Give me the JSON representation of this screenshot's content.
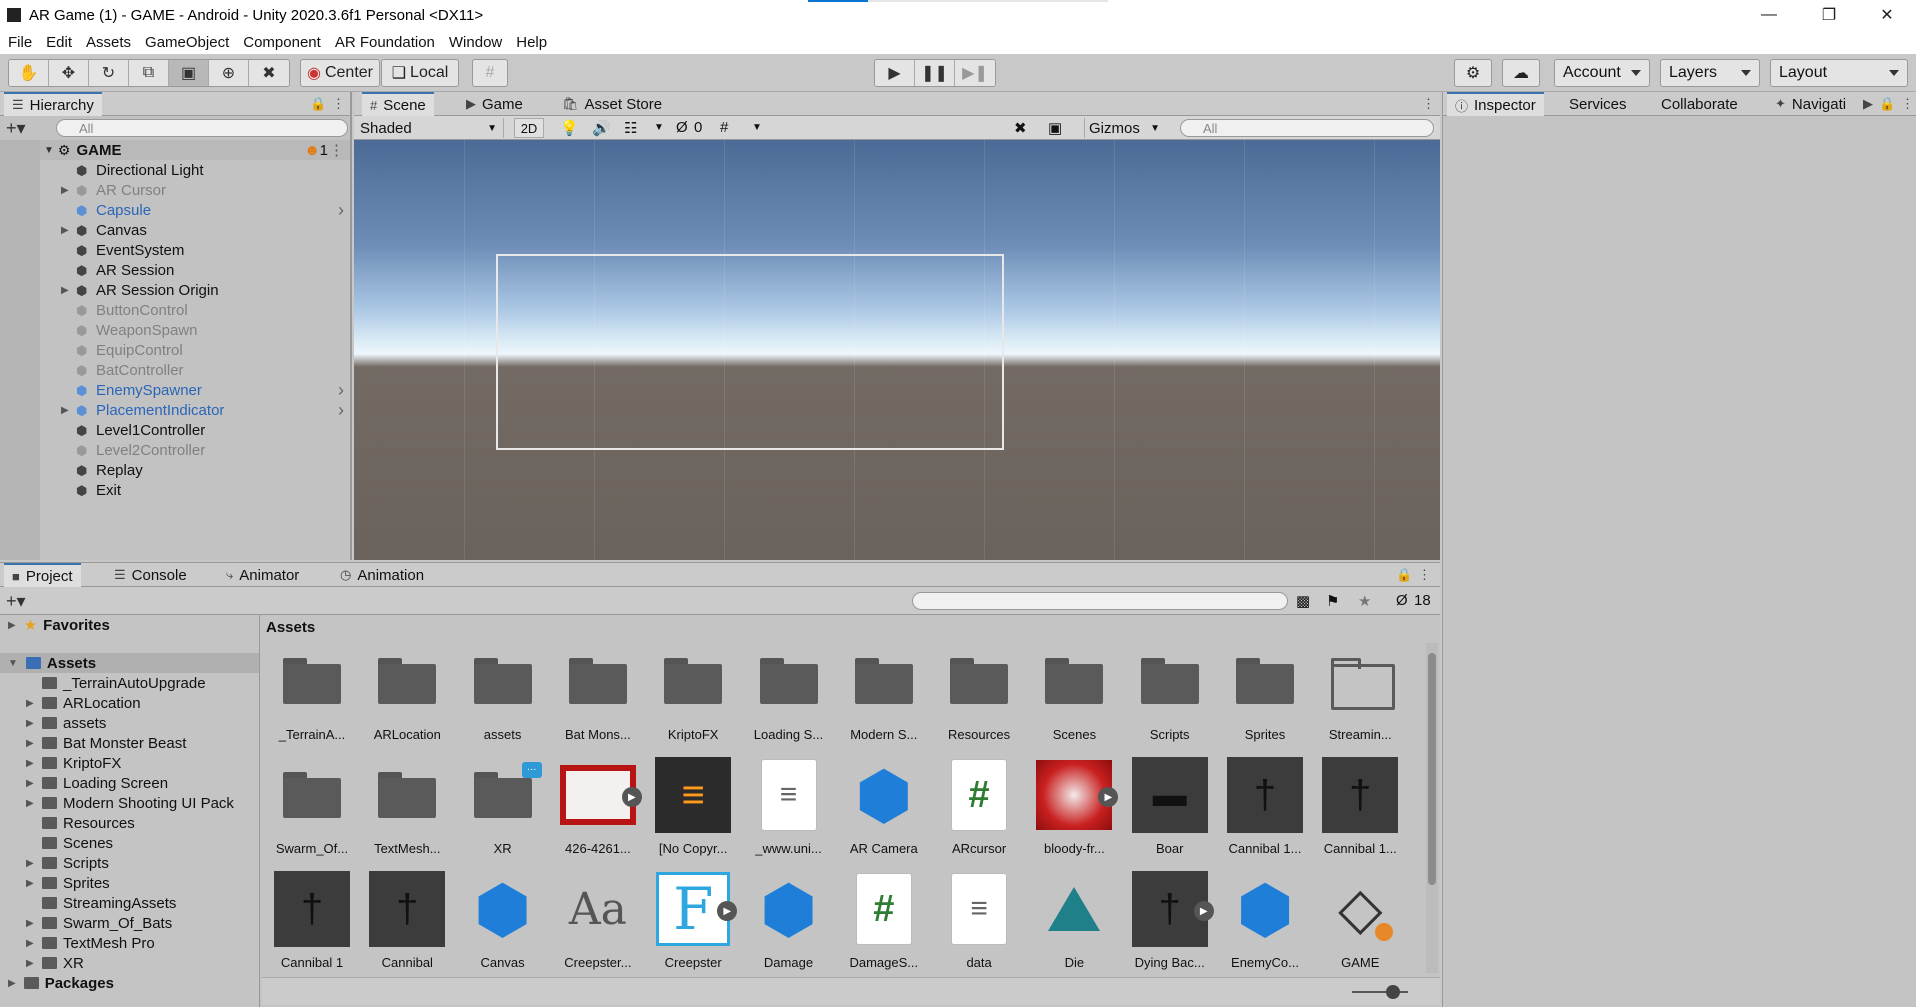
{
  "window": {
    "title": "AR Game (1) - GAME - Android - Unity 2020.3.6f1 Personal <DX11>"
  },
  "menu": [
    "File",
    "Edit",
    "Assets",
    "GameObject",
    "Component",
    "AR Foundation",
    "Window",
    "Help"
  ],
  "toolbar": {
    "pivot": "Center",
    "space": "Local",
    "account": "Account",
    "layers": "Layers",
    "layout": "Layout"
  },
  "hierarchy": {
    "tab": "Hierarchy",
    "search_placeholder": "All",
    "scene_name": "GAME",
    "scene_badge": "1",
    "items": [
      {
        "label": "Directional Light",
        "state": "normal",
        "expandable": false
      },
      {
        "label": "AR Cursor",
        "state": "dim",
        "expandable": true
      },
      {
        "label": "Capsule",
        "state": "blue",
        "expandable": false,
        "more": true
      },
      {
        "label": "Canvas",
        "state": "normal",
        "expandable": true
      },
      {
        "label": "EventSystem",
        "state": "normal",
        "expandable": false
      },
      {
        "label": "AR Session",
        "state": "normal",
        "expandable": false
      },
      {
        "label": "AR Session Origin",
        "state": "normal",
        "expandable": true
      },
      {
        "label": "ButtonControl",
        "state": "dim",
        "expandable": false
      },
      {
        "label": "WeaponSpawn",
        "state": "dim",
        "expandable": false
      },
      {
        "label": "EquipControl",
        "state": "dim",
        "expandable": false
      },
      {
        "label": "BatController",
        "state": "dim",
        "expandable": false
      },
      {
        "label": "EnemySpawner",
        "state": "blue",
        "expandable": false,
        "more": true
      },
      {
        "label": "PlacementIndicator",
        "state": "blue",
        "expandable": true,
        "more": true
      },
      {
        "label": "Level1Controller",
        "state": "normal",
        "expandable": false
      },
      {
        "label": "Level2Controller",
        "state": "dim",
        "expandable": false
      },
      {
        "label": "Replay",
        "state": "normal",
        "expandable": false
      },
      {
        "label": "Exit",
        "state": "normal",
        "expandable": false
      }
    ]
  },
  "scene": {
    "tabs": [
      "Scene",
      "Game",
      "Asset Store"
    ],
    "shading": "Shaded",
    "mode_2d": "2D",
    "hidden_count": "0",
    "gizmos": "Gizmos",
    "search_placeholder": "All"
  },
  "inspector": {
    "tabs": [
      "Inspector",
      "Services",
      "Collaborate",
      "Navigati"
    ]
  },
  "project": {
    "tabs": [
      "Project",
      "Console",
      "Animator",
      "Animation"
    ],
    "hidden_count": "18",
    "breadcrumb": "Assets",
    "favorites": "Favorites",
    "assets_root": "Assets",
    "packages": "Packages",
    "tree": [
      {
        "label": "_TerrainAutoUpgrade",
        "expandable": false
      },
      {
        "label": "ARLocation",
        "expandable": true
      },
      {
        "label": "assets",
        "expandable": true
      },
      {
        "label": "Bat Monster Beast",
        "expandable": true
      },
      {
        "label": "KriptoFX",
        "expandable": true
      },
      {
        "label": "Loading Screen",
        "expandable": true
      },
      {
        "label": "Modern Shooting UI Pack",
        "expandable": true
      },
      {
        "label": "Resources",
        "expandable": false
      },
      {
        "label": "Scenes",
        "expandable": false
      },
      {
        "label": "Scripts",
        "expandable": true
      },
      {
        "label": "Sprites",
        "expandable": true
      },
      {
        "label": "StreamingAssets",
        "expandable": false
      },
      {
        "label": "Swarm_Of_Bats",
        "expandable": true
      },
      {
        "label": "TextMesh Pro",
        "expandable": true
      },
      {
        "label": "XR",
        "expandable": true
      }
    ],
    "assets": [
      {
        "label": "_TerrainA...",
        "kind": "folder"
      },
      {
        "label": "ARLocation",
        "kind": "folder"
      },
      {
        "label": "assets",
        "kind": "folder"
      },
      {
        "label": "Bat Mons...",
        "kind": "folder"
      },
      {
        "label": "KriptoFX",
        "kind": "folder"
      },
      {
        "label": "Loading S...",
        "kind": "folder"
      },
      {
        "label": "Modern S...",
        "kind": "folder"
      },
      {
        "label": "Resources",
        "kind": "folder"
      },
      {
        "label": "Scenes",
        "kind": "folder"
      },
      {
        "label": "Scripts",
        "kind": "folder"
      },
      {
        "label": "Sprites",
        "kind": "folder"
      },
      {
        "label": "Streamin...",
        "kind": "folder-outline"
      },
      {
        "label": "Swarm_Of...",
        "kind": "folder"
      },
      {
        "label": "TextMesh...",
        "kind": "folder"
      },
      {
        "label": "XR",
        "kind": "folder-badge"
      },
      {
        "label": "426-4261...",
        "kind": "texture-red",
        "play": true
      },
      {
        "label": "[No Copyr...",
        "kind": "audio"
      },
      {
        "label": "_www.uni...",
        "kind": "text"
      },
      {
        "label": "AR Camera",
        "kind": "cube"
      },
      {
        "label": "ARcursor",
        "kind": "script"
      },
      {
        "label": "bloody-fr...",
        "kind": "texture-blood",
        "play": true
      },
      {
        "label": "Boar",
        "kind": "model-boar"
      },
      {
        "label": "Cannibal 1...",
        "kind": "model-man"
      },
      {
        "label": "Cannibal 1...",
        "kind": "model-man"
      },
      {
        "label": "Cannibal 1",
        "kind": "model-man"
      },
      {
        "label": "Cannibal",
        "kind": "model-man"
      },
      {
        "label": "Canvas",
        "kind": "cube"
      },
      {
        "label": "Creepster...",
        "kind": "font-aa"
      },
      {
        "label": "Creepster",
        "kind": "font-f",
        "play": true
      },
      {
        "label": "Damage",
        "kind": "cube"
      },
      {
        "label": "DamageS...",
        "kind": "script"
      },
      {
        "label": "data",
        "kind": "text"
      },
      {
        "label": "Die",
        "kind": "anim"
      },
      {
        "label": "Dying Bac...",
        "kind": "model-man",
        "play": true
      },
      {
        "label": "EnemyCo...",
        "kind": "cube"
      },
      {
        "label": "GAME",
        "kind": "unity"
      }
    ]
  }
}
